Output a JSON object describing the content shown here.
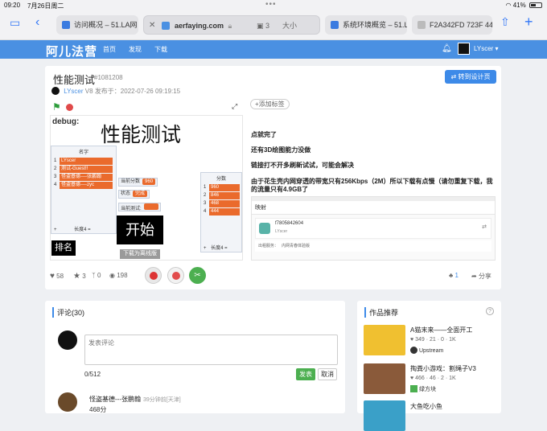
{
  "status": {
    "time": "09:20",
    "date": "7月26日周二",
    "battery": "41%"
  },
  "tabs": [
    {
      "label": "访问概况 – 51.LA网"
    },
    {
      "label": "aerfaying.com",
      "tab_count": "3",
      "extra": "大小"
    },
    {
      "label": "系统环境概览 – 51.L"
    },
    {
      "label": "F2A342FD 723F 44"
    }
  ],
  "site": {
    "logo": "阿儿法营",
    "nav": [
      "首页",
      "发现",
      "下载"
    ],
    "username": "LYscer"
  },
  "project": {
    "title": "性能测试",
    "id": "#1081208",
    "author": "LYscer",
    "level": "V8",
    "published": "发布于：2022-07-26 09:19:15",
    "design_button": "转到设计页",
    "add_tag": "+添加标签"
  },
  "stage": {
    "debug": "debug:",
    "heading": "性能测试",
    "names_list": {
      "header": "名字",
      "rows": [
        {
          "n": "1",
          "v": "LYscer"
        },
        {
          "n": "2",
          "v": "测试-Guest!!"
        },
        {
          "n": "3",
          "v": "怪盗基德----张鹏翰"
        },
        {
          "n": "4",
          "v": "怪盗基德----zyc"
        }
      ],
      "footer": "长度4"
    },
    "score_list": {
      "header": "分数",
      "rows": [
        {
          "n": "1",
          "v": "960"
        },
        {
          "n": "2",
          "v": "846"
        },
        {
          "n": "3",
          "v": "468"
        },
        {
          "n": "4",
          "v": "444"
        }
      ],
      "footer": "长度4"
    },
    "monitors": [
      {
        "label": "当前分数",
        "value": "960"
      },
      {
        "label": "状态",
        "value": "完成"
      },
      {
        "label": "当前测试:",
        "value": ""
      }
    ],
    "start": "开始",
    "rank": "排名",
    "offline": "下载为离线版"
  },
  "description": [
    "点就完了",
    "还有3D绘图能力没做",
    "链接打不开多刷新试试，可能会解决",
    "由于花生壳内网穿透的带宽只有256Kbps（2M）所以下载有点慢（请勿重复下载，我的流量只有4.9GB了"
  ],
  "embedded_screenshot": {
    "title": "映射",
    "item_id": "f7805842604",
    "item_user": "LYscer",
    "row_label": "出租服务：",
    "row_value": "内网青春体验版"
  },
  "stats": {
    "likes": "58",
    "stars": "3",
    "forks": "0",
    "views": "198",
    "share_count": "1",
    "share": "分享"
  },
  "comments": {
    "title": "评论(30)",
    "placeholder": "发表评论",
    "counter": "0/512",
    "submit": "发表",
    "cancel": "取消",
    "first_user": "怪盗基德---张鹏翰",
    "first_time": "39分钟前[天津]",
    "first_text": "468分"
  },
  "works": {
    "title": "作品推荐",
    "items": [
      {
        "title": "A猫末来——全面开工",
        "stats": "349 · 21 · 0 · 1K",
        "author": "Upstream"
      },
      {
        "title": "掏粪小游戏：割绳子V3",
        "stats": "466 · 46 · 2 · 1K",
        "author": "绿方块"
      },
      {
        "title": "大鱼吃小鱼",
        "stats": "",
        "author": ""
      }
    ]
  }
}
